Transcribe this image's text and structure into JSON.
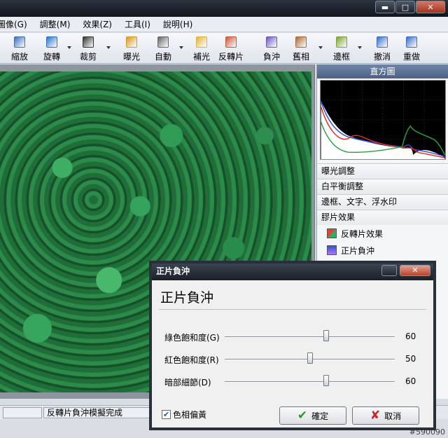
{
  "menu": [
    "圖像(G)",
    "調整(M)",
    "效果(Z)",
    "工具(I)",
    "說明(H)"
  ],
  "toolbar": [
    {
      "label": "縮放",
      "icon": "zoom-icon",
      "color": "#3d6fb8"
    },
    {
      "label": "旋轉",
      "icon": "rotate-icon",
      "color": "#2e72c9"
    },
    {
      "label": "裁剪",
      "icon": "crop-icon",
      "color": "#333333"
    },
    {
      "label": "曝光",
      "icon": "exposure-icon",
      "color": "#d39a22"
    },
    {
      "label": "自動",
      "icon": "auto-icon",
      "color": "#666666"
    },
    {
      "label": "補光",
      "icon": "fill-light-icon",
      "color": "#e0b43c"
    },
    {
      "label": "反轉片",
      "icon": "reversal-film-icon",
      "color": "#c8563b"
    },
    {
      "label": "負沖",
      "icon": "cross-process-icon",
      "color": "#6f58b9"
    },
    {
      "label": "舊相",
      "icon": "old-photo-icon",
      "color": "#a86a3a"
    },
    {
      "label": "邊框",
      "icon": "frame-icon",
      "color": "#7ba23a"
    },
    {
      "label": "撤消",
      "icon": "undo-icon",
      "color": "#3a6fc6"
    },
    {
      "label": "重做",
      "icon": "redo-icon",
      "color": "#3a6fc6"
    }
  ],
  "panel": {
    "header": "直方圖",
    "sections": [
      "曝光調整",
      "白平衡調整",
      "邊框、文字、浮水印",
      "膠片效果"
    ],
    "items": [
      "反轉片效果",
      "正片負沖"
    ],
    "histogram_colors": {
      "red": "#e03020",
      "green": "#28a040",
      "blue": "#3050e0",
      "white": "#ffffff"
    }
  },
  "status": {
    "message": "反轉片負沖模擬完成"
  },
  "watermark": "#590090",
  "dialog": {
    "title": "正片負沖",
    "heading": "正片負沖",
    "sliders": [
      {
        "label": "綠色飽和度(G)",
        "value": "60",
        "fraction": 0.6
      },
      {
        "label": "紅色飽和度(R)",
        "value": "50",
        "fraction": 0.5
      },
      {
        "label": "暗部細節(D)",
        "value": "60",
        "fraction": 0.6
      }
    ],
    "checkbox_label": "色相偏黃",
    "checkbox_checked": true,
    "ok_label": "確定",
    "cancel_label": "取消"
  }
}
